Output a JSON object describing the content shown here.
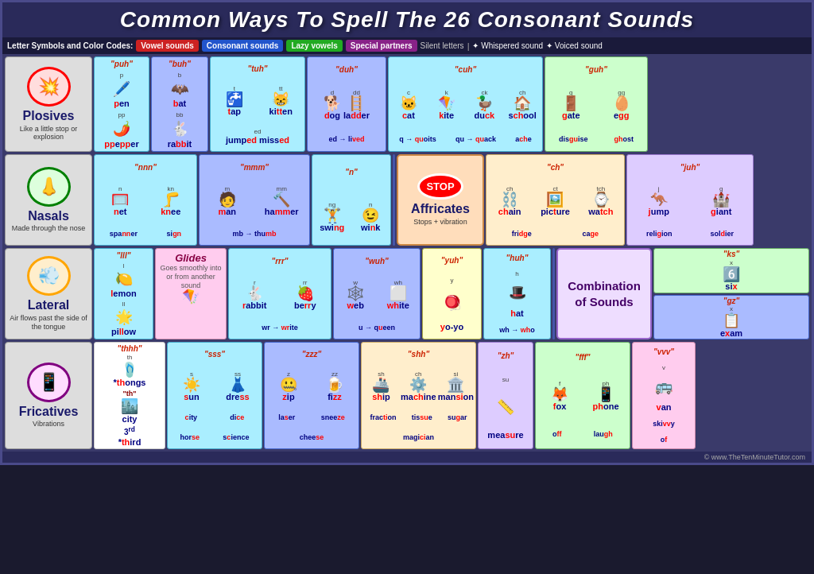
{
  "title": "Common Ways To Spell The 26 Consonant Sounds",
  "legend": {
    "label": "Letter Symbols and Color Codes:",
    "vowel": "Vowel sounds",
    "consonant": "Consonant sounds",
    "lazy": "Lazy vowels",
    "special": "Special partners",
    "silent": "Silent letters",
    "whisper": "✦ Whispered sound",
    "voiced": "✦ Voiced sound"
  },
  "rows": {
    "plosives": {
      "title": "Plosives",
      "desc": "Like a little stop or explosion",
      "icon": "💥",
      "sounds": [
        {
          "title": "\"puh\"",
          "letters": [
            "p"
          ],
          "word": "pen",
          "word2": "pepper",
          "img": "🖊️",
          "img2": "🌶️"
        },
        {
          "title": "\"buh\"",
          "letters": [
            "b",
            "bb"
          ],
          "word": "bat",
          "word2": "rabbit",
          "img": "🦇",
          "img2": "🐇"
        },
        {
          "title": "\"tuh\"",
          "letters": [
            "t",
            "tt",
            "ed"
          ],
          "word": "tap",
          "word2": "kitten jumped missed",
          "img": "🚰"
        },
        {
          "title": "\"duh\"",
          "letters": [
            "d",
            "dd",
            "ed"
          ],
          "word": "dog",
          "word2": "ladder lived",
          "img": "🐕"
        },
        {
          "title": "\"cuh\"",
          "letters": [
            "c",
            "k",
            "ck",
            "ch",
            "q"
          ],
          "word": "cat kite duck school quoits quack ache",
          "img": "🐱"
        },
        {
          "title": "\"guh\"",
          "letters": [
            "g",
            "gg",
            "gh",
            "gu"
          ],
          "word": "gate egg ghost disguise",
          "img": "🚪"
        }
      ]
    },
    "nasals": {
      "title": "Nasals",
      "desc": "Made through the nose",
      "icon": "👃",
      "sounds": [
        {
          "title": "\"nnn\"",
          "letters": [
            "n",
            "kn",
            "nn",
            "gn"
          ],
          "word": "net knee spanner sign"
        },
        {
          "title": "\"mmm\"",
          "letters": [
            "m",
            "mm",
            "mb"
          ],
          "word": "man hammer thumb"
        },
        {
          "title": "\"n\"",
          "letters": [
            "ng",
            "n"
          ],
          "word": "swing wink"
        }
      ]
    },
    "affricates": {
      "title": "Affricates",
      "desc": "Stops + vibration",
      "sounds": [
        {
          "title": "\"ch\"",
          "letters": [
            "ch",
            "tch",
            "t"
          ],
          "word": "chain watch picture fridge cage"
        },
        {
          "title": "\"juh\"",
          "letters": [
            "j",
            "g",
            "ge",
            "d"
          ],
          "word": "jump giant religion soldier"
        }
      ]
    },
    "lateral": {
      "title": "Lateral",
      "desc": "Air flows past the side of the tongue",
      "icon": "💨",
      "sounds": [
        {
          "title": "\"lll\"",
          "letters": [
            "l",
            "ll"
          ],
          "word": "lemon pillow"
        },
        {
          "title": "\"rrr\"",
          "letters": [
            "r",
            "rr",
            "wr"
          ],
          "word": "rabbit berry write"
        },
        {
          "title": "\"wuh\"",
          "letters": [
            "w",
            "wh",
            "u"
          ],
          "word": "web white queen"
        },
        {
          "title": "\"yuh\"",
          "letters": [
            "y"
          ],
          "word": "yo-yo"
        },
        {
          "title": "\"huh\"",
          "letters": [
            "h",
            "wh"
          ],
          "word": "hat who"
        }
      ]
    },
    "combination": {
      "title": "Combination\nof Sounds"
    },
    "fricatives": {
      "title": "Fricatives",
      "desc": "Vibrations",
      "icon": "📱",
      "sounds": [
        {
          "title": "\"thhh\"",
          "letters": [
            "th"
          ],
          "word": "'thongs",
          "word2": "\"th\"",
          "word3": "city 3rd *third"
        },
        {
          "title": "\"sss\"",
          "letters": [
            "s",
            "ss",
            "c",
            "ce",
            "sc"
          ],
          "word": "sun dress city dice horse science"
        },
        {
          "title": "\"zzz\"",
          "letters": [
            "z",
            "zz",
            "s"
          ],
          "word": "zip fizz laser sneeze cheese"
        },
        {
          "title": "\"shh\"",
          "letters": [
            "sh",
            "ch",
            "ti",
            "ci"
          ],
          "word": "ship machine fraction tissue magician"
        },
        {
          "title": "\"zh\"",
          "letters": [
            "su"
          ],
          "word": "measure"
        },
        {
          "title": "\"fff\"",
          "letters": [
            "f",
            "ff",
            "ph",
            "gh"
          ],
          "word": "fox off phone laugh"
        },
        {
          "title": "\"vvv\"",
          "letters": [
            "v",
            "vv",
            "f"
          ],
          "word": "van skivvy of"
        }
      ]
    }
  },
  "footer": "© www.TheTenMinuteTutor.com"
}
